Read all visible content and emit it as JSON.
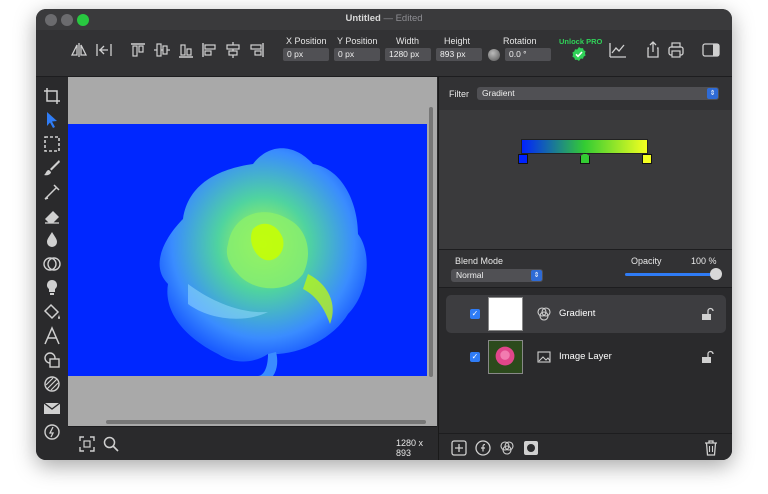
{
  "window": {
    "title": "Untitled",
    "title_suffix": "— Edited"
  },
  "toolbar": {
    "x_label": "X Position",
    "x_value": "0 px",
    "y_label": "Y Position",
    "y_value": "0 px",
    "width_label": "Width",
    "width_value": "1280 px",
    "height_label": "Height",
    "height_value": "893 px",
    "rotation_label": "Rotation",
    "rotation_value": "0.0 °",
    "unlock_label": "Unlock PRO",
    "colors": {
      "accent_green": "#30d158"
    }
  },
  "canvas": {
    "dimensions": "1280 x 893",
    "image_colors": {
      "background": "#0027ff",
      "petal": "#5ab8ff",
      "highlight": "#c8ff00"
    }
  },
  "filter": {
    "label": "Filter",
    "selected": "Gradient",
    "gradient_stops": [
      "#0022ff",
      "#33cc33",
      "#f4ff20"
    ]
  },
  "blend": {
    "mode_label": "Blend Mode",
    "mode_value": "Normal",
    "opacity_label": "Opacity",
    "opacity_value": "100 %",
    "opacity_level": 1.0
  },
  "layers": [
    {
      "name": "Gradient",
      "checked": true,
      "selected": true
    },
    {
      "name": "Image Layer",
      "checked": true,
      "selected": false
    }
  ]
}
